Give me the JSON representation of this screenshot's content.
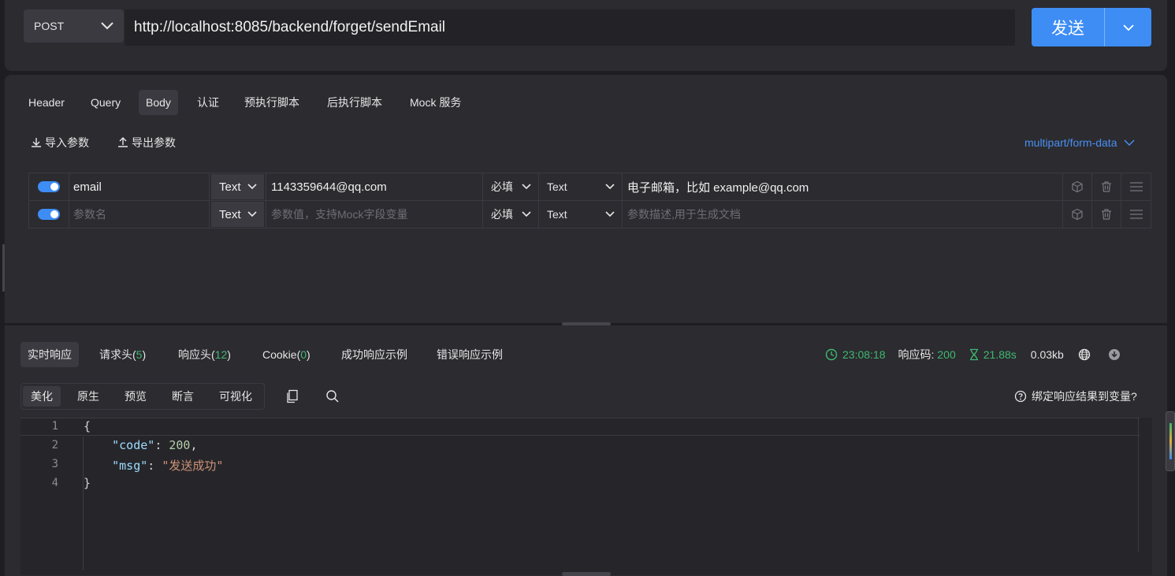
{
  "request": {
    "method": "POST",
    "url": "http://localhost:8085/backend/forget/sendEmail",
    "send_label": "发送"
  },
  "req_tabs": [
    "Header",
    "Query",
    "Body",
    "认证",
    "预执行脚本",
    "后执行脚本",
    "Mock 服务"
  ],
  "req_tab_active": "Body",
  "body": {
    "import_label": "导入参数",
    "export_label": "导出参数",
    "content_type": "multipart/form-data",
    "rows": [
      {
        "name": "email",
        "type": "Text",
        "value": "1143359644@qq.com",
        "required": "必填",
        "field_type": "Text",
        "desc": "电子邮箱，比如 example@qq.com",
        "enabled": true
      },
      {
        "name_placeholder": "参数名",
        "type": "Text",
        "value_placeholder": "参数值，支持Mock字段变量",
        "required": "必填",
        "field_type": "Text",
        "desc_placeholder": "参数描述,用于生成文档",
        "enabled": true
      }
    ]
  },
  "resp_tabs": [
    {
      "label": "实时响应",
      "active": true
    },
    {
      "label": "请求头(",
      "count": "5",
      "close": ")"
    },
    {
      "label": "响应头(",
      "count": "12",
      "close": ")"
    },
    {
      "label": "Cookie(",
      "count": "0",
      "close": ")"
    },
    {
      "label": "成功响应示例"
    },
    {
      "label": "错误响应示例"
    }
  ],
  "status": {
    "time": "23:08:18",
    "code_label": "响应码:",
    "code": "200",
    "duration": "21.88s",
    "size": "0.03kb"
  },
  "view_tabs": [
    "美化",
    "原生",
    "预览",
    "断言",
    "可视化"
  ],
  "bind_label": "绑定响应结果到变量?",
  "code_lines": [
    "1",
    "2",
    "3",
    "4"
  ],
  "json": {
    "open": "{",
    "code_key": "\"code\"",
    "code_val": "200",
    "msg_key": "\"msg\"",
    "msg_val": "\"发送成功\"",
    "close": "}"
  },
  "colors": {
    "accent": "#3d8df5",
    "success": "#3fb96f",
    "panel": "#2b2b30"
  }
}
